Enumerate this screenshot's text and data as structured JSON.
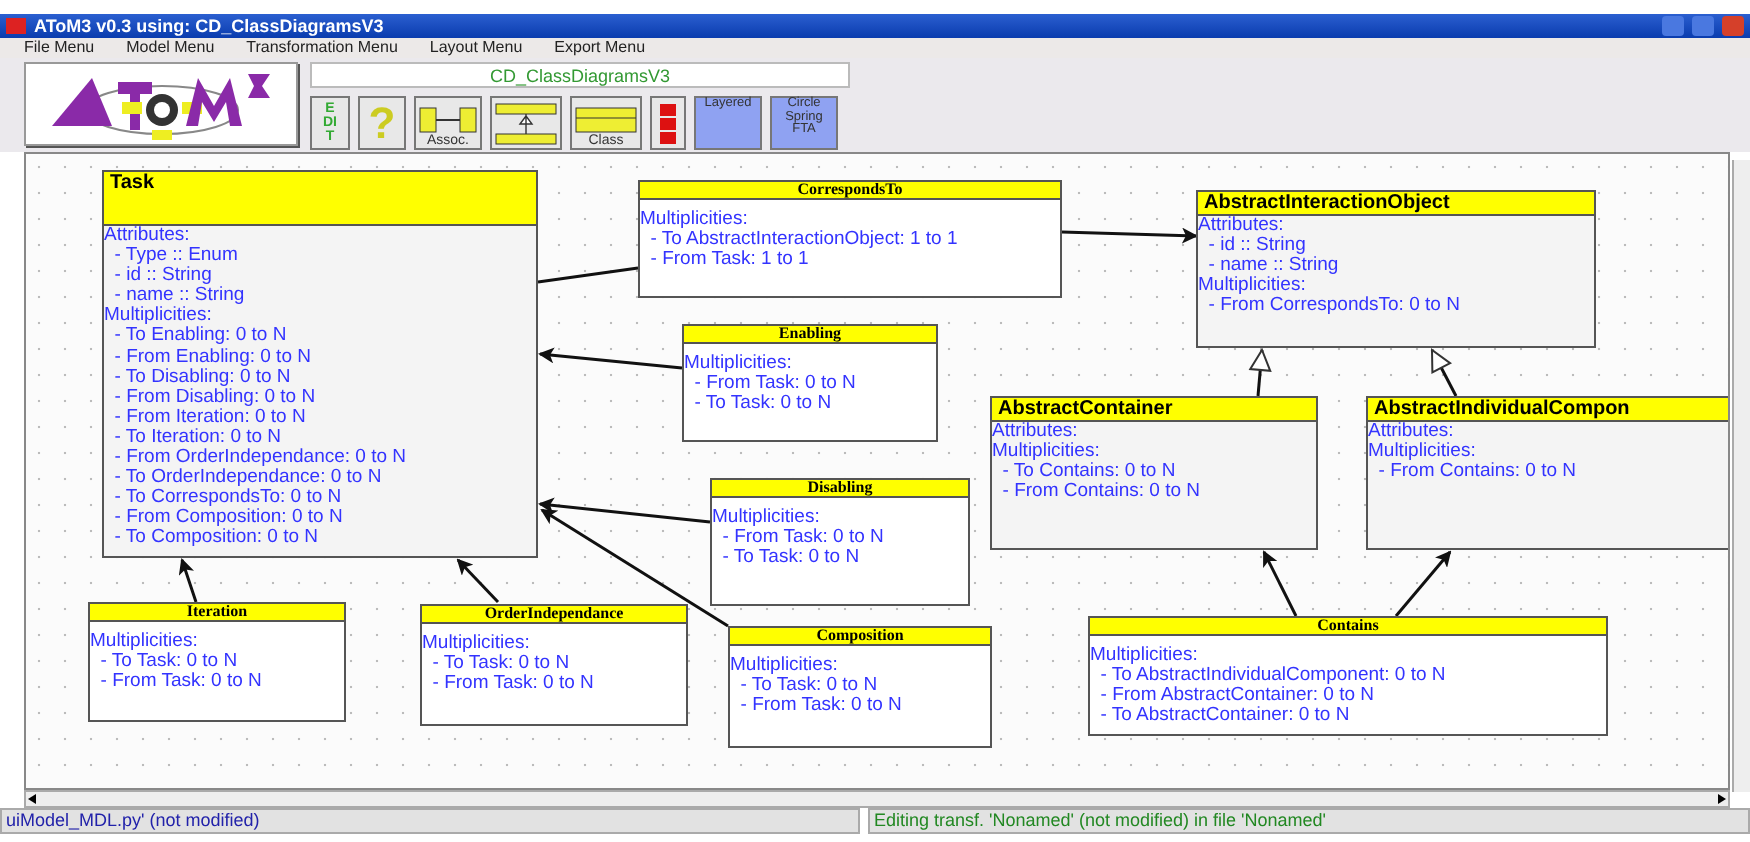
{
  "window": {
    "title": "AToM3 v0.3 using: CD_ClassDiagramsV3"
  },
  "menus": [
    "File Menu",
    "Model Menu",
    "Transformation Menu",
    "Layout Menu",
    "Export Menu"
  ],
  "toolbar": {
    "model_name": "CD_ClassDiagramsV3",
    "buttons": [
      {
        "kind": "vertical",
        "label": "EDIT"
      },
      {
        "kind": "help",
        "label": "?"
      },
      {
        "kind": "assoc",
        "label": "Assoc."
      },
      {
        "kind": "inherit"
      },
      {
        "kind": "class",
        "label": "Class"
      },
      {
        "kind": "red"
      },
      {
        "kind": "layout",
        "label": "Layered"
      },
      {
        "kind": "layout",
        "label": "Circle Spring FTA"
      }
    ]
  },
  "diagram": {
    "nodes": [
      {
        "kind": "class",
        "title": "Task",
        "lines": [
          "Attributes:",
          "  - Type :: Enum",
          "  - id :: String",
          "  - name :: String",
          "Multiplicities:",
          "  - To Enabling: 0 to N",
          "  - From Enabling: 0 to N",
          "  - To Disabling: 0 to N",
          "  - From Disabling: 0 to N",
          "  - From Iteration: 0 to N",
          "  - To Iteration: 0 to N",
          "  - From OrderIndependance: 0 to N",
          "  - To OrderIndependance: 0 to N",
          "  - To CorrespondsTo: 0 to N",
          "  - From Composition: 0 to N",
          "  - To Composition: 0 to N"
        ]
      },
      {
        "kind": "association",
        "title": "CorrespondsTo",
        "lines": [
          "Multiplicities:",
          "  - To AbstractInteractionObject: 1 to 1",
          "  - From Task: 1 to 1"
        ]
      },
      {
        "kind": "association",
        "title": "Enabling",
        "lines": [
          "Multiplicities:",
          "  - From Task: 0 to N",
          "  - To Task: 0 to N"
        ]
      },
      {
        "kind": "association",
        "title": "Disabling",
        "lines": [
          "Multiplicities:",
          "  - From Task: 0 to N",
          "  - To Task: 0 to N"
        ]
      },
      {
        "kind": "class",
        "title": "AbstractInteractionObject",
        "lines": [
          "Attributes:",
          "  - id :: String",
          "  - name :: String",
          "Multiplicities:",
          "  - From CorrespondsTo: 0 to N"
        ]
      },
      {
        "kind": "class",
        "title": "AbstractContainer",
        "lines": [
          "Attributes:",
          "Multiplicities:",
          "  - To Contains: 0 to N",
          "  - From Contains: 0 to N"
        ]
      },
      {
        "kind": "class",
        "title": "AbstractIndividualCompon",
        "lines": [
          "Attributes:",
          "Multiplicities:",
          "  - From Contains: 0 to N"
        ]
      },
      {
        "kind": "association",
        "title": "Iteration",
        "lines": [
          "Multiplicities:",
          "  - To Task: 0 to N",
          "  - From Task: 0 to N"
        ]
      },
      {
        "kind": "association",
        "title": "OrderIndependance",
        "lines": [
          "Multiplicities:",
          "  - To Task: 0 to N",
          "  - From Task: 0 to N"
        ]
      },
      {
        "kind": "association",
        "title": "Composition",
        "lines": [
          "Multiplicities:",
          "  - To Task: 0 to N",
          "  - From Task: 0 to N"
        ]
      },
      {
        "kind": "association",
        "title": "Contains",
        "lines": [
          "Multiplicities:",
          "  - To AbstractIndividualComponent: 0 to N",
          "  - From AbstractContainer: 0 to N",
          "  - To AbstractContainer: 0 to N"
        ]
      }
    ],
    "edges": [
      {
        "arrowhead": false
      },
      {
        "arrowhead": true,
        "hollow": false
      },
      {
        "arrowhead": true,
        "hollow": false
      },
      {
        "arrowhead": true,
        "hollow": false
      },
      {
        "arrowhead": true,
        "hollow": false
      },
      {
        "arrowhead": true,
        "hollow": false
      },
      {
        "arrowhead": true,
        "hollow": false
      },
      {
        "arrowhead": true,
        "hollow": true
      },
      {
        "arrowhead": true,
        "hollow": true
      },
      {
        "arrowhead": true,
        "hollow": false
      },
      {
        "arrowhead": true,
        "hollow": false
      }
    ]
  },
  "status_bar": {
    "left": "uiModel_MDL.py' (not modified)",
    "right": "Editing transf. 'Nonamed' (not modified) in file 'Nonamed'"
  }
}
